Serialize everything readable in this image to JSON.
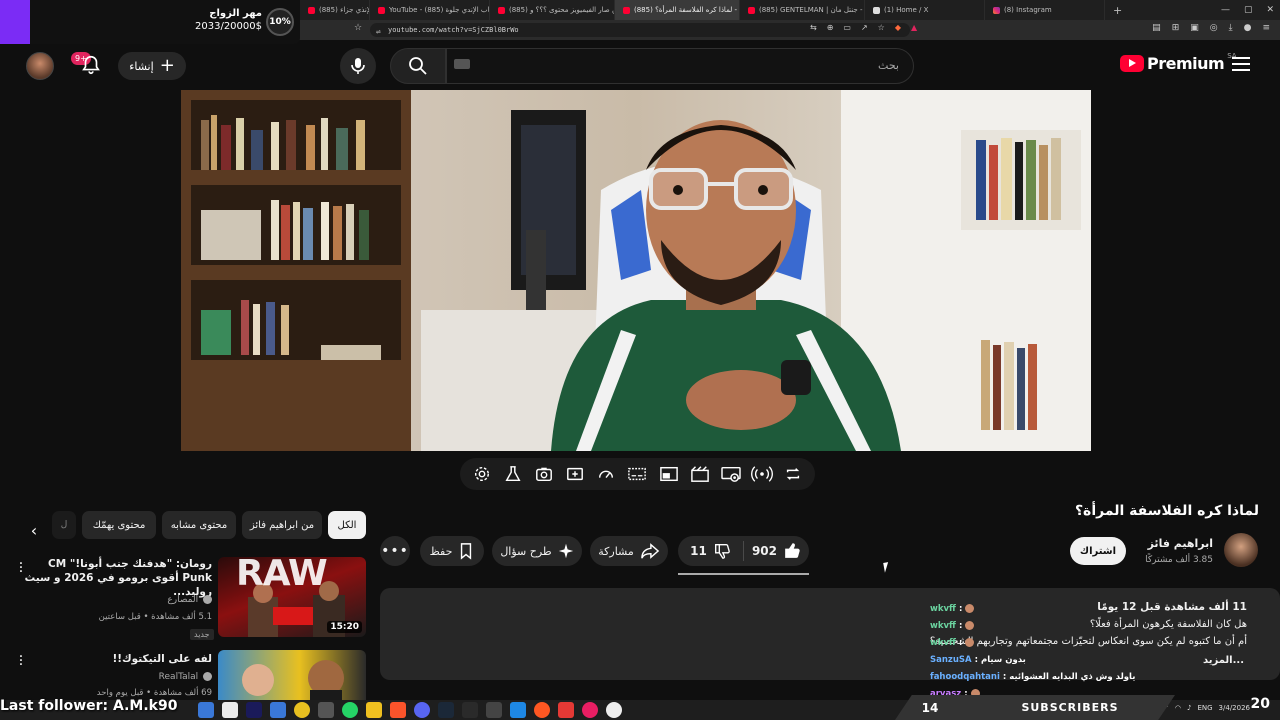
{
  "browser": {
    "tabs": [
      {
        "label": "(885) أتعاب الإنذي جزاء ...",
        "icon": "youtube-icon",
        "active": false
      },
      {
        "label": "YouTube - أتعاب الإندي جلوة (885)",
        "icon": "youtube-icon",
        "active": false
      },
      {
        "label": "(885) ليش صار الفيميويز محتوى ؟؟؟ و...",
        "icon": "youtube-icon",
        "active": false
      },
      {
        "label": "(885) لماذا كره الفلاسفة المرأة؟ - ...",
        "icon": "youtube-icon",
        "active": true
      },
      {
        "label": "(885) GENTELMAN | جنتل مان - YouT...",
        "icon": "youtube-icon",
        "active": false
      },
      {
        "label": "(1) Home / X",
        "icon": "x-icon",
        "active": false
      },
      {
        "label": "(8) Instagram",
        "icon": "instagram-icon",
        "active": false
      }
    ],
    "new_tab": "+",
    "url": "youtube.com/watch?v=SjCZBl0BrWo"
  },
  "donation": {
    "title": "مهر الزواج",
    "amount": "2033/20000$",
    "percent": "10%"
  },
  "header": {
    "notification_count": "9+",
    "create_label": "إنشاء",
    "search_placeholder": "بحث",
    "logo_text": "Premium",
    "country_code": "SA"
  },
  "video": {
    "title": "لماذا كره الفلاسفة المرأة؟",
    "channel_name": "ابراهيم فائز",
    "subscribers": "3.85 ألف مشتركًا",
    "subscribe_label": "اشتراك",
    "likes": "902",
    "dislikes": "11",
    "share_label": "مشاركة",
    "ask_label": "طرح سؤال",
    "save_label": "حفظ"
  },
  "chips": {
    "all": "الكل",
    "from_channel": "من ابراهيم فائز",
    "similar": "محتوى مشابه",
    "for_you": "محتوى يهمّك",
    "more": "ل"
  },
  "recommendations": [
    {
      "title": "رومان: \"هدفنك جنب أبونا!\" CM Punk أقوى برومو في 2026 و سيث روليد...",
      "channel": "المصارع",
      "meta": "5.1 ألف مشاهدة • قبل ساعتين",
      "badge": "جديد",
      "duration": "15:20",
      "thumb_text": "RAW"
    },
    {
      "title": "لفه على التيكتوك!!",
      "channel": "RealTalal",
      "meta": "69 ألف مشاهدة • قبل يوم واحد",
      "duration": "",
      "thumb_text": ""
    }
  ],
  "description": {
    "views_line": "11 ألف مشاهدة  قبل 12 يومًا",
    "line1": "هل كان الفلاسفة يكرهون المرأة فعلًا؟",
    "line2": "أم أن ما كتبوه لم يكن سوى انعكاس لتحيّزات مجتمعاتهم وتجاربهم الشخصية؟",
    "more": "...المزيد"
  },
  "chat": [
    {
      "user": "wkvff",
      "message": ""
    },
    {
      "user": "wkvff",
      "message": ""
    },
    {
      "user": "wkvff",
      "message": ""
    },
    {
      "user": "SanzuSA",
      "message": "بدون سيام"
    },
    {
      "user": "fahoodqahtani",
      "message": "ياولد وش ذي البدايه العشوائيه"
    },
    {
      "user": "aryasz",
      "message": ""
    }
  ],
  "stream_overlay": {
    "last_follower": "Last follower: A.M.k90",
    "sub_count": "14",
    "sub_label": "SUBSCRIBERS",
    "clock": "20"
  },
  "taskbar": {
    "lang": "ENG",
    "time": "",
    "date": "3/4/2026"
  },
  "colors": {
    "background": "#0f0f0f",
    "surface": "#272727",
    "accent": "#ff0033",
    "donation_bar": "#7b2cf5"
  }
}
